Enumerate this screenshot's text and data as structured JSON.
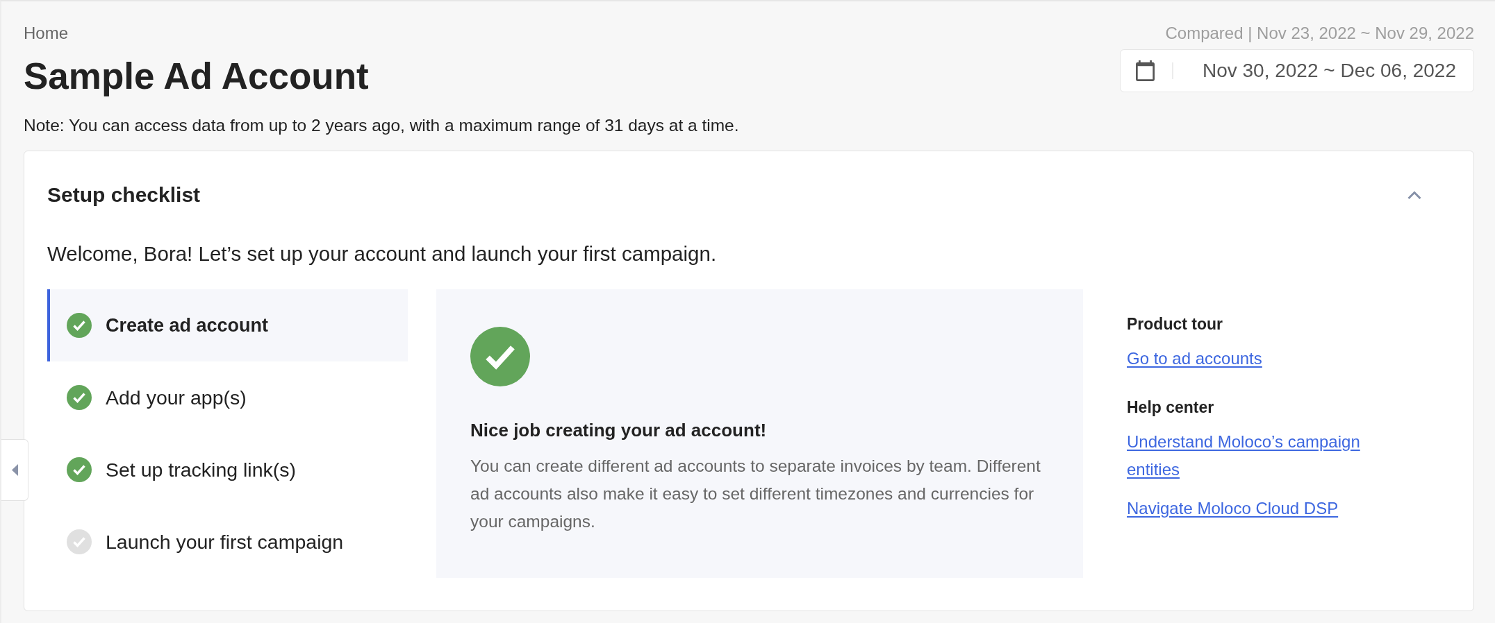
{
  "breadcrumb": "Home",
  "title": "Sample Ad Account",
  "date_range": {
    "compared": "Compared | Nov 23, 2022 ~ Nov 29, 2022",
    "value": "Nov 30, 2022 ~ Dec 06, 2022"
  },
  "note": "Note: You can access data from up to 2 years ago, with a maximum range of 31 days at a time.",
  "checklist": {
    "title": "Setup checklist",
    "expanded": true,
    "welcome": "Welcome, Bora! Let’s set up your account and launch your first campaign.",
    "steps": [
      {
        "label": "Create ad account",
        "done": true,
        "selected": true
      },
      {
        "label": "Add your app(s)",
        "done": true,
        "selected": false
      },
      {
        "label": "Set up tracking link(s)",
        "done": true,
        "selected": false
      },
      {
        "label": "Launch your first campaign",
        "done": false,
        "selected": false
      }
    ],
    "detail": {
      "done": true,
      "heading": "Nice job creating your ad account!",
      "body": "You can create different ad accounts to separate invoices by team. Different ad accounts also make it easy to set different timezones and currencies for your campaigns."
    },
    "resources": [
      {
        "heading": "Product tour",
        "links": [
          "Go to ad accounts"
        ]
      },
      {
        "heading": "Help center",
        "links": [
          "Understand Moloco’s campaign entities",
          "Navigate Moloco Cloud DSP"
        ]
      }
    ]
  }
}
